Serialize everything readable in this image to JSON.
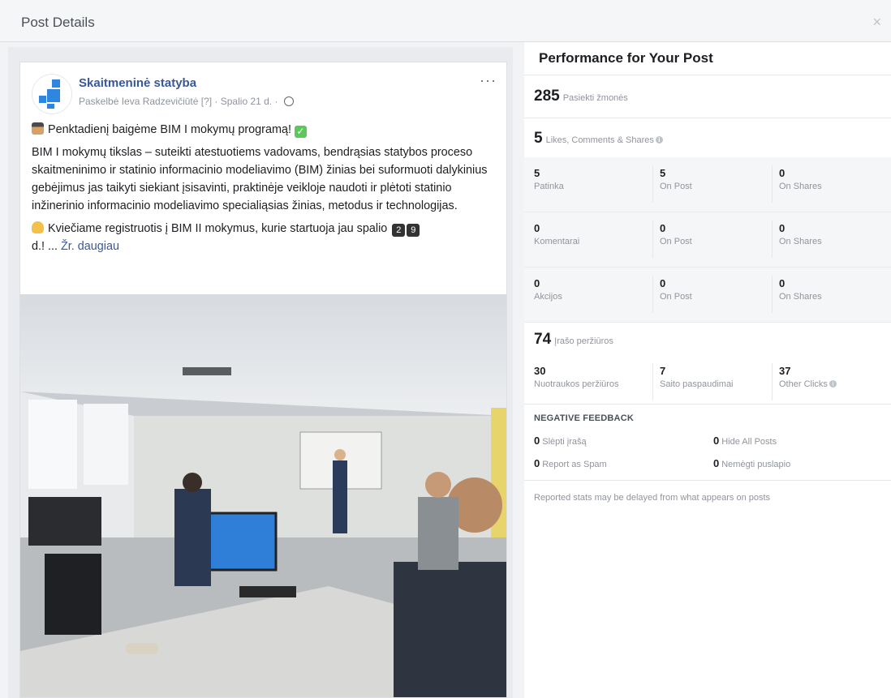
{
  "dialog": {
    "title": "Post Details",
    "close": "×"
  },
  "post": {
    "page_name": "Skaitmeninė statyba",
    "byline": "Paskelbė Ieva Radzevičiūtė [?] · Spalio 21 d. ·",
    "more": "···",
    "line1": "Penktadienį baigėme BIM I mokymų programą!",
    "body": "BIM I mokymų tikslas – suteikti atestuotiems vadovams, bendrąsias statybos proceso skaitmeninimo ir statinio informacinio modeliavimo (BIM) žinias bei suformuoti dalykinius gebėjimus jas taikyti siekiant įsisavinti, praktinėje veikloje naudoti ir plėtoti statinio inžinerinio informacinio modeliavimo specialiąsias žinias, metodus ir technologijas.",
    "invite": "Kviečiame registruotis į BIM II mokymus, kurie startuoja jau spalio",
    "key1": "2",
    "key2": "9",
    "invite_end": "d.! ...",
    "see_more": "Žr. daugiau"
  },
  "performance": {
    "title": "Performance for Your Post",
    "reach": {
      "value": "285",
      "label": "Pasiekti žmonės"
    },
    "engagement": {
      "value": "5",
      "label": "Likes, Comments & Shares"
    },
    "rows": [
      [
        {
          "v": "5",
          "l": "Patinka"
        },
        {
          "v": "5",
          "l": "On Post"
        },
        {
          "v": "0",
          "l": "On Shares"
        }
      ],
      [
        {
          "v": "0",
          "l": "Komentarai"
        },
        {
          "v": "0",
          "l": "On Post"
        },
        {
          "v": "0",
          "l": "On Shares"
        }
      ],
      [
        {
          "v": "0",
          "l": "Akcijos"
        },
        {
          "v": "0",
          "l": "On Post"
        },
        {
          "v": "0",
          "l": "On Shares"
        }
      ]
    ],
    "clicks": {
      "value": "74",
      "label": "Įrašo peržiūros"
    },
    "click_breakdown": [
      {
        "v": "30",
        "l": "Nuotraukos peržiūros"
      },
      {
        "v": "7",
        "l": "Saito paspaudimai"
      },
      {
        "v": "37",
        "l": "Other Clicks"
      }
    ],
    "negative": {
      "title": "NEGATIVE FEEDBACK",
      "hide_post": {
        "v": "0",
        "l": "Slėpti įrašą"
      },
      "hide_all": {
        "v": "0",
        "l": "Hide All Posts"
      },
      "spam": {
        "v": "0",
        "l": "Report as Spam"
      },
      "unlike": {
        "v": "0",
        "l": "Nemėgti puslapio"
      }
    },
    "note": "Reported stats may be delayed from what appears on posts"
  },
  "icons": {
    "close": "close-icon",
    "more": "more-options-icon",
    "globe": "globe-icon",
    "info": "info-icon"
  },
  "colors": {
    "link": "#385898",
    "muted": "#90949c",
    "panel_bg": "#f5f6f7"
  }
}
